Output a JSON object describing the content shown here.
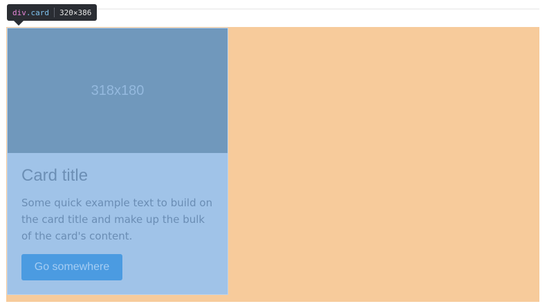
{
  "tooltip": {
    "tag": "div",
    "class": ".card",
    "size": "320×386"
  },
  "card": {
    "image_label": "318x180",
    "title": "Card title",
    "text": "Some quick example text to build on the card title and make up the bulk of the card's content.",
    "button_label": "Go somewhere"
  },
  "colors": {
    "container_highlight": "#f7cb9b",
    "card_body": "#a0c3e8",
    "card_image": "#7098bc",
    "button": "#4b9be1",
    "tooltip_bg": "#2a2d33"
  }
}
